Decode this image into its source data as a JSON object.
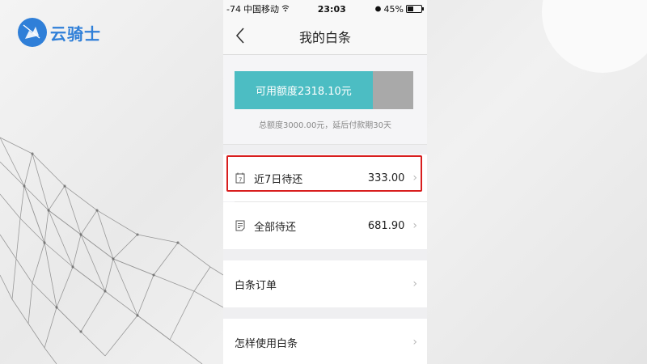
{
  "brand": {
    "name": "云骑士",
    "color": "#2f7fd8"
  },
  "statusbar": {
    "signal": "-74",
    "carrier": "中国移动",
    "time": "23:03",
    "battery": "45%"
  },
  "navbar": {
    "title": "我的白条",
    "back_icon": "chevron-left-icon"
  },
  "credit": {
    "available_label": "可用额度2318.10元",
    "available_fraction": 0.773,
    "note": "总额度3000.00元，延后付款期30天",
    "fill_color": "#4cbdc3",
    "empty_color": "#a9a9a9"
  },
  "rows": [
    {
      "label": "近7日待还",
      "amount": "333.00",
      "icon": "calendar-7-icon"
    },
    {
      "label": "全部待还",
      "amount": "681.90",
      "icon": "document-list-icon"
    },
    {
      "label": "白条订单",
      "amount": ""
    },
    {
      "label": "怎样使用白条",
      "amount": ""
    }
  ],
  "highlight_color": "#d81e1e"
}
